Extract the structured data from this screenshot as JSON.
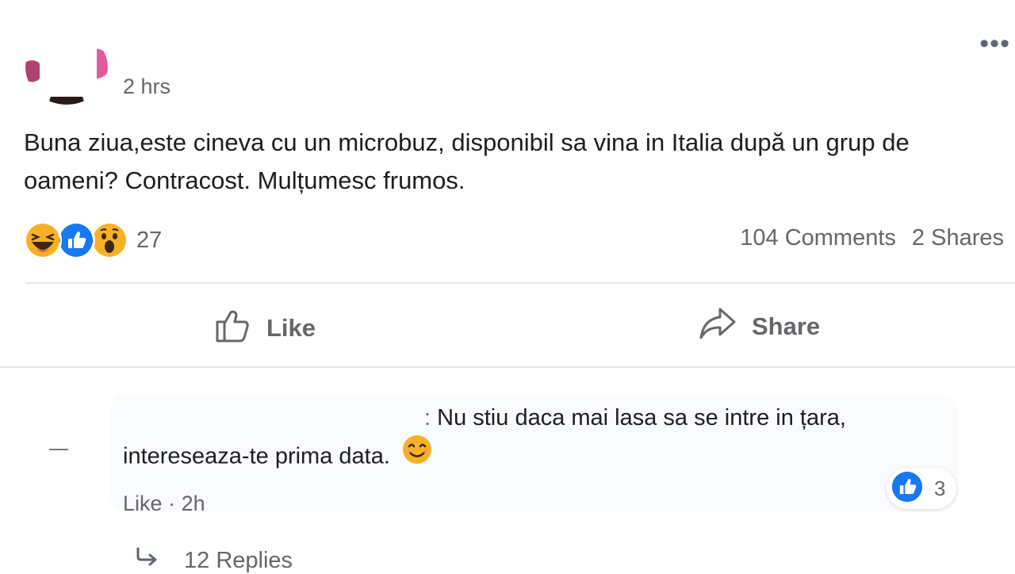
{
  "post": {
    "time": "2 hrs",
    "more_label": "•••",
    "text": "Buna ziua,este cineva cu un microbuz, disponibil sa vina in Italia după un grup de oameni? Contracost. Mulțumesc frumos.",
    "reactions": {
      "icons": [
        "haha-icon",
        "like-icon",
        "wow-icon"
      ],
      "count": "27"
    },
    "comments_label": "104 Comments",
    "shares_label": "2 Shares"
  },
  "actions": {
    "like_label": "Like",
    "share_label": "Share"
  },
  "comment": {
    "separator": ":",
    "text": "Nu stiu daca mai lasa sa se intre in țara, intereseaza-te prima data.",
    "emoji": "smiling-face-icon",
    "reaction_count": "3",
    "like_label": "Like",
    "dot": "·",
    "time": "2h",
    "replies_label": "12 Replies"
  },
  "colors": {
    "text": "#1c1e21",
    "secondary": "#65676b",
    "like_blue": "#1877f2",
    "reaction_yellow": "#f7b125"
  }
}
